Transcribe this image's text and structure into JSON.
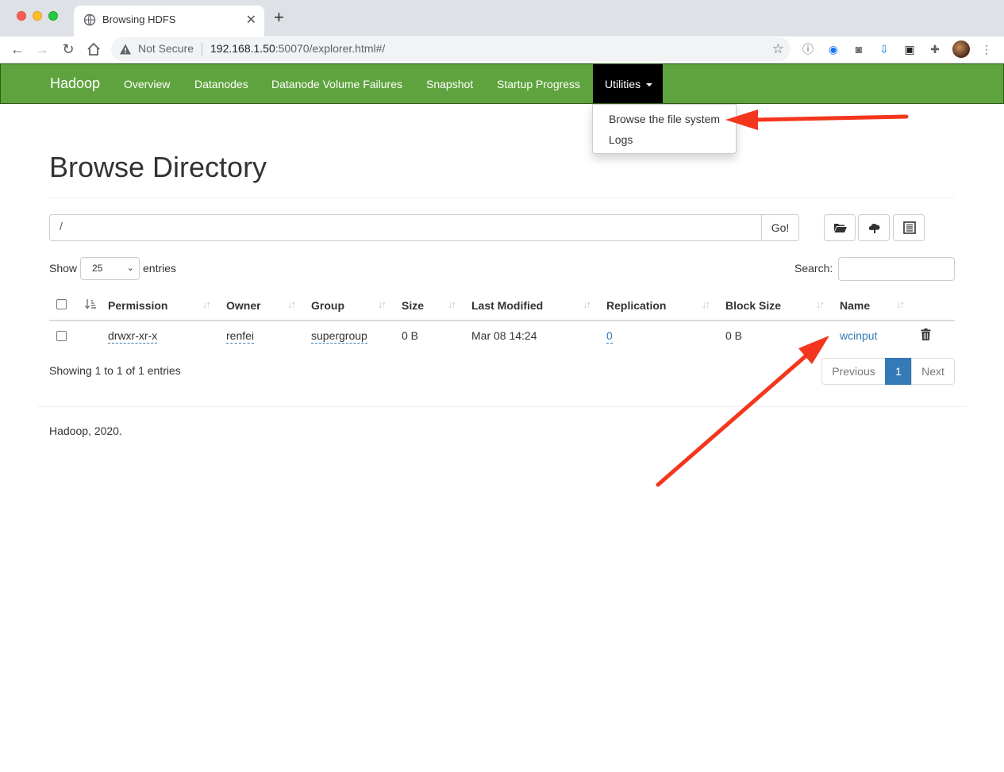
{
  "browser": {
    "tab_title": "Browsing HDFS",
    "security_label": "Not Secure",
    "url_host": "192.168.1.50",
    "url_rest": ":50070/explorer.html#/"
  },
  "navbar": {
    "brand": "Hadoop",
    "items": [
      "Overview",
      "Datanodes",
      "Datanode Volume Failures",
      "Snapshot",
      "Startup Progress"
    ],
    "utilities_label": "Utilities",
    "dropdown": [
      "Browse the file system",
      "Logs"
    ]
  },
  "page": {
    "title": "Browse Directory",
    "path_value": "/",
    "go_label": "Go!",
    "show_label": "Show",
    "entries_value": "25",
    "entries_label": "entries",
    "search_label": "Search:"
  },
  "table": {
    "headers": [
      "Permission",
      "Owner",
      "Group",
      "Size",
      "Last Modified",
      "Replication",
      "Block Size",
      "Name"
    ],
    "rows": [
      {
        "permission": "drwxr-xr-x",
        "owner": "renfei",
        "group": "supergroup",
        "size": "0 B",
        "last_modified": "Mar 08 14:24",
        "replication": "0",
        "block_size": "0 B",
        "name": "wcinput"
      }
    ]
  },
  "pagination": {
    "info": "Showing 1 to 1 of 1 entries",
    "previous": "Previous",
    "current": "1",
    "next": "Next"
  },
  "footer": {
    "text": "Hadoop, 2020."
  },
  "colors": {
    "navbar": "#5fa33e",
    "active_nav": "#000000",
    "link": "#337ab7",
    "annotation_arrow": "#f4361e"
  }
}
